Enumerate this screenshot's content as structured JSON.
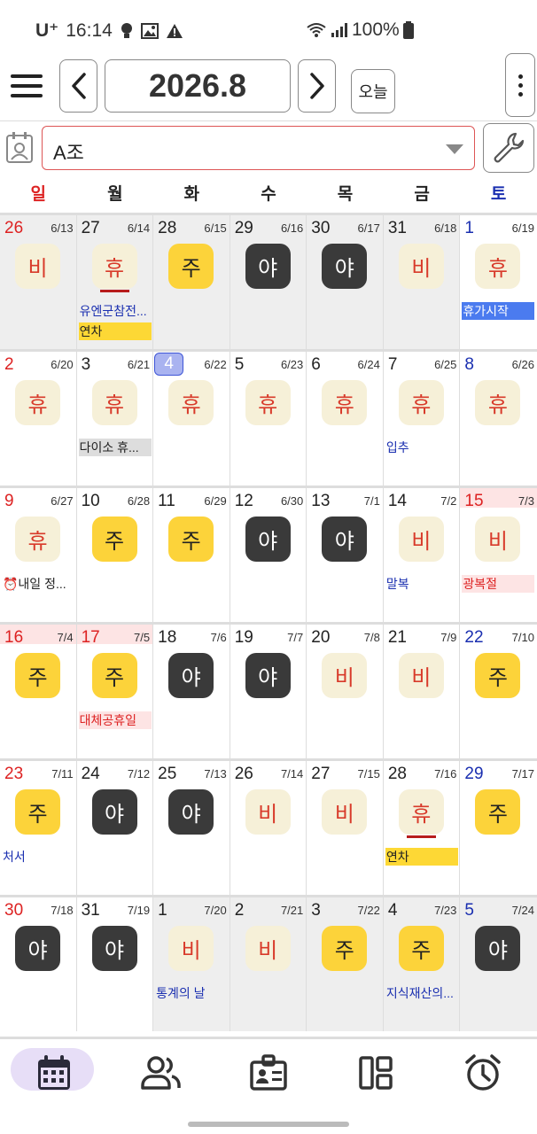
{
  "status_bar": {
    "carrier": "U⁺",
    "time": "16:14",
    "battery": "100%"
  },
  "header": {
    "month": "2026.8",
    "today_label": "오늘"
  },
  "group": {
    "selected": "A조"
  },
  "weekdays": [
    "일",
    "월",
    "화",
    "수",
    "목",
    "금",
    "토"
  ],
  "weeks": [
    [
      {
        "day": "26",
        "lunar": "6/13",
        "other": true,
        "color": "red",
        "shift": "비",
        "type": "bi"
      },
      {
        "day": "27",
        "lunar": "6/14",
        "other": true,
        "shift": "휴",
        "type": "hyu",
        "underline": true,
        "events": [
          {
            "text": "유엔군참전...",
            "style": "blue"
          },
          {
            "text": "연차",
            "style": "yellow"
          }
        ]
      },
      {
        "day": "28",
        "lunar": "6/15",
        "other": true,
        "shift": "주",
        "type": "ju"
      },
      {
        "day": "29",
        "lunar": "6/16",
        "other": true,
        "shift": "야",
        "type": "ya"
      },
      {
        "day": "30",
        "lunar": "6/17",
        "other": true,
        "shift": "야",
        "type": "ya"
      },
      {
        "day": "31",
        "lunar": "6/18",
        "other": true,
        "shift": "비",
        "type": "bi"
      },
      {
        "day": "1",
        "lunar": "6/19",
        "color": "blue",
        "shift": "휴",
        "type": "hyu",
        "events": [
          {
            "text": "휴가시작",
            "style": "bluebar"
          }
        ]
      }
    ],
    [
      {
        "day": "2",
        "lunar": "6/20",
        "color": "red",
        "shift": "휴",
        "type": "hyu"
      },
      {
        "day": "3",
        "lunar": "6/21",
        "shift": "휴",
        "type": "hyu",
        "events": [
          {
            "text": "다이소 휴...",
            "style": "grey"
          }
        ]
      },
      {
        "day": "4",
        "lunar": "6/22",
        "today": true,
        "shift": "휴",
        "type": "hyu"
      },
      {
        "day": "5",
        "lunar": "6/23",
        "shift": "휴",
        "type": "hyu"
      },
      {
        "day": "6",
        "lunar": "6/24",
        "shift": "휴",
        "type": "hyu"
      },
      {
        "day": "7",
        "lunar": "6/25",
        "shift": "휴",
        "type": "hyu",
        "events": [
          {
            "text": "입추",
            "style": "blue"
          }
        ]
      },
      {
        "day": "8",
        "lunar": "6/26",
        "color": "blue",
        "shift": "휴",
        "type": "hyu"
      }
    ],
    [
      {
        "day": "9",
        "lunar": "6/27",
        "color": "red",
        "shift": "휴",
        "type": "hyu",
        "events": [
          {
            "text": "⏰내일 정...",
            "style": "black"
          }
        ]
      },
      {
        "day": "10",
        "lunar": "6/28",
        "shift": "주",
        "type": "ju"
      },
      {
        "day": "11",
        "lunar": "6/29",
        "shift": "주",
        "type": "ju"
      },
      {
        "day": "12",
        "lunar": "6/30",
        "shift": "야",
        "type": "ya"
      },
      {
        "day": "13",
        "lunar": "7/1",
        "shift": "야",
        "type": "ya"
      },
      {
        "day": "14",
        "lunar": "7/2",
        "shift": "비",
        "type": "bi",
        "events": [
          {
            "text": "말복",
            "style": "blue"
          }
        ]
      },
      {
        "day": "15",
        "lunar": "7/3",
        "color": "red",
        "holiday": true,
        "shift": "비",
        "type": "bi",
        "events": [
          {
            "text": "광복절",
            "style": "pink"
          }
        ]
      }
    ],
    [
      {
        "day": "16",
        "lunar": "7/4",
        "color": "red",
        "holiday": true,
        "shift": "주",
        "type": "ju"
      },
      {
        "day": "17",
        "lunar": "7/5",
        "color": "red",
        "holiday": true,
        "shift": "주",
        "type": "ju",
        "events": [
          {
            "text": "대체공휴일",
            "style": "pink"
          }
        ]
      },
      {
        "day": "18",
        "lunar": "7/6",
        "shift": "야",
        "type": "ya"
      },
      {
        "day": "19",
        "lunar": "7/7",
        "shift": "야",
        "type": "ya"
      },
      {
        "day": "20",
        "lunar": "7/8",
        "shift": "비",
        "type": "bi"
      },
      {
        "day": "21",
        "lunar": "7/9",
        "shift": "비",
        "type": "bi"
      },
      {
        "day": "22",
        "lunar": "7/10",
        "color": "blue",
        "shift": "주",
        "type": "ju"
      }
    ],
    [
      {
        "day": "23",
        "lunar": "7/11",
        "color": "red",
        "shift": "주",
        "type": "ju",
        "events": [
          {
            "text": "처서",
            "style": "blue"
          }
        ]
      },
      {
        "day": "24",
        "lunar": "7/12",
        "shift": "야",
        "type": "ya"
      },
      {
        "day": "25",
        "lunar": "7/13",
        "shift": "야",
        "type": "ya"
      },
      {
        "day": "26",
        "lunar": "7/14",
        "shift": "비",
        "type": "bi"
      },
      {
        "day": "27",
        "lunar": "7/15",
        "shift": "비",
        "type": "bi"
      },
      {
        "day": "28",
        "lunar": "7/16",
        "shift": "휴",
        "type": "hyu",
        "underline": true,
        "events": [
          {
            "text": "연차",
            "style": "yellow"
          }
        ]
      },
      {
        "day": "29",
        "lunar": "7/17",
        "color": "blue",
        "shift": "주",
        "type": "ju"
      }
    ],
    [
      {
        "day": "30",
        "lunar": "7/18",
        "color": "red",
        "shift": "야",
        "type": "ya"
      },
      {
        "day": "31",
        "lunar": "7/19",
        "shift": "야",
        "type": "ya"
      },
      {
        "day": "1",
        "lunar": "7/20",
        "other": true,
        "shift": "비",
        "type": "bi",
        "events": [
          {
            "text": "통계의 날",
            "style": "blue"
          }
        ]
      },
      {
        "day": "2",
        "lunar": "7/21",
        "other": true,
        "shift": "비",
        "type": "bi"
      },
      {
        "day": "3",
        "lunar": "7/22",
        "other": true,
        "shift": "주",
        "type": "ju"
      },
      {
        "day": "4",
        "lunar": "7/23",
        "other": true,
        "shift": "주",
        "type": "ju",
        "events": [
          {
            "text": "지식재산의...",
            "style": "blue"
          }
        ]
      },
      {
        "day": "5",
        "lunar": "7/24",
        "other": true,
        "color": "blue",
        "shift": "야",
        "type": "ya"
      }
    ]
  ],
  "colors": {
    "sunday": "#d22222",
    "saturday": "#1a2fb0",
    "shift_day": "#fcd33a",
    "shift_night": "#3a3a3a",
    "shift_off": "#f6f0d8",
    "annual_leave": "#fdd835",
    "today_marker": "#a9b3f0",
    "nav_active": "#e7def7"
  },
  "bottom_nav": [
    "calendar-icon",
    "people-icon",
    "id-card-icon",
    "dashboard-icon",
    "alarm-icon"
  ]
}
